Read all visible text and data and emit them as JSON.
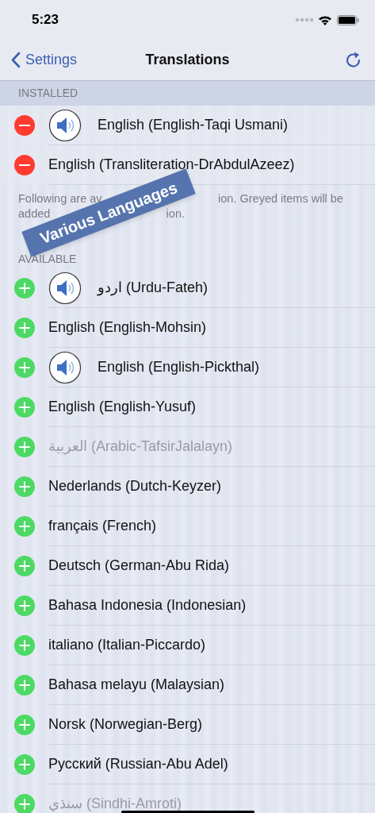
{
  "status_bar": {
    "time": "5:23"
  },
  "nav": {
    "back": "Settings",
    "title": "Translations"
  },
  "sections": [
    {
      "header": "INSTALLED",
      "kind": "remove",
      "items": [
        {
          "label": "English (English-Taqi Usmani)",
          "audio": true,
          "disabled": false
        },
        {
          "label": "English (Transliteration-DrAbdulAzeez)",
          "audio": false,
          "disabled": false
        }
      ]
    },
    {
      "header": "AVAILABLE",
      "kind": "add",
      "items": [
        {
          "label": "اردو (Urdu-Fateh)",
          "audio": true,
          "disabled": false
        },
        {
          "label": "English (English-Mohsin)",
          "audio": false,
          "disabled": false
        },
        {
          "label": "English (English-Pickthal)",
          "audio": true,
          "disabled": false
        },
        {
          "label": "English (English-Yusuf)",
          "audio": false,
          "disabled": false
        },
        {
          "label": "العربية (Arabic-TafsirJalalayn)",
          "audio": false,
          "disabled": true
        },
        {
          "label": "Nederlands (Dutch-Keyzer)",
          "audio": false,
          "disabled": false
        },
        {
          "label": "français (French)",
          "audio": false,
          "disabled": false
        },
        {
          "label": "Deutsch (German-Abu Rida)",
          "audio": false,
          "disabled": false
        },
        {
          "label": "Bahasa Indonesia (Indonesian)",
          "audio": false,
          "disabled": false
        },
        {
          "label": "italiano (Italian-Piccardo)",
          "audio": false,
          "disabled": false
        },
        {
          "label": "Bahasa melayu (Malaysian)",
          "audio": false,
          "disabled": false
        },
        {
          "label": "Norsk (Norwegian-Berg)",
          "audio": false,
          "disabled": false
        },
        {
          "label": "Русский (Russian-Abu Adel)",
          "audio": false,
          "disabled": false
        },
        {
          "label": "سنڌي (Sindhi-Amroti)",
          "audio": false,
          "disabled": true
        }
      ]
    }
  ],
  "footnote": [
    [
      "Following are av",
      "ion. Greyed items will be"
    ],
    [
      "added",
      "ion."
    ]
  ],
  "banner": "Various Languages"
}
